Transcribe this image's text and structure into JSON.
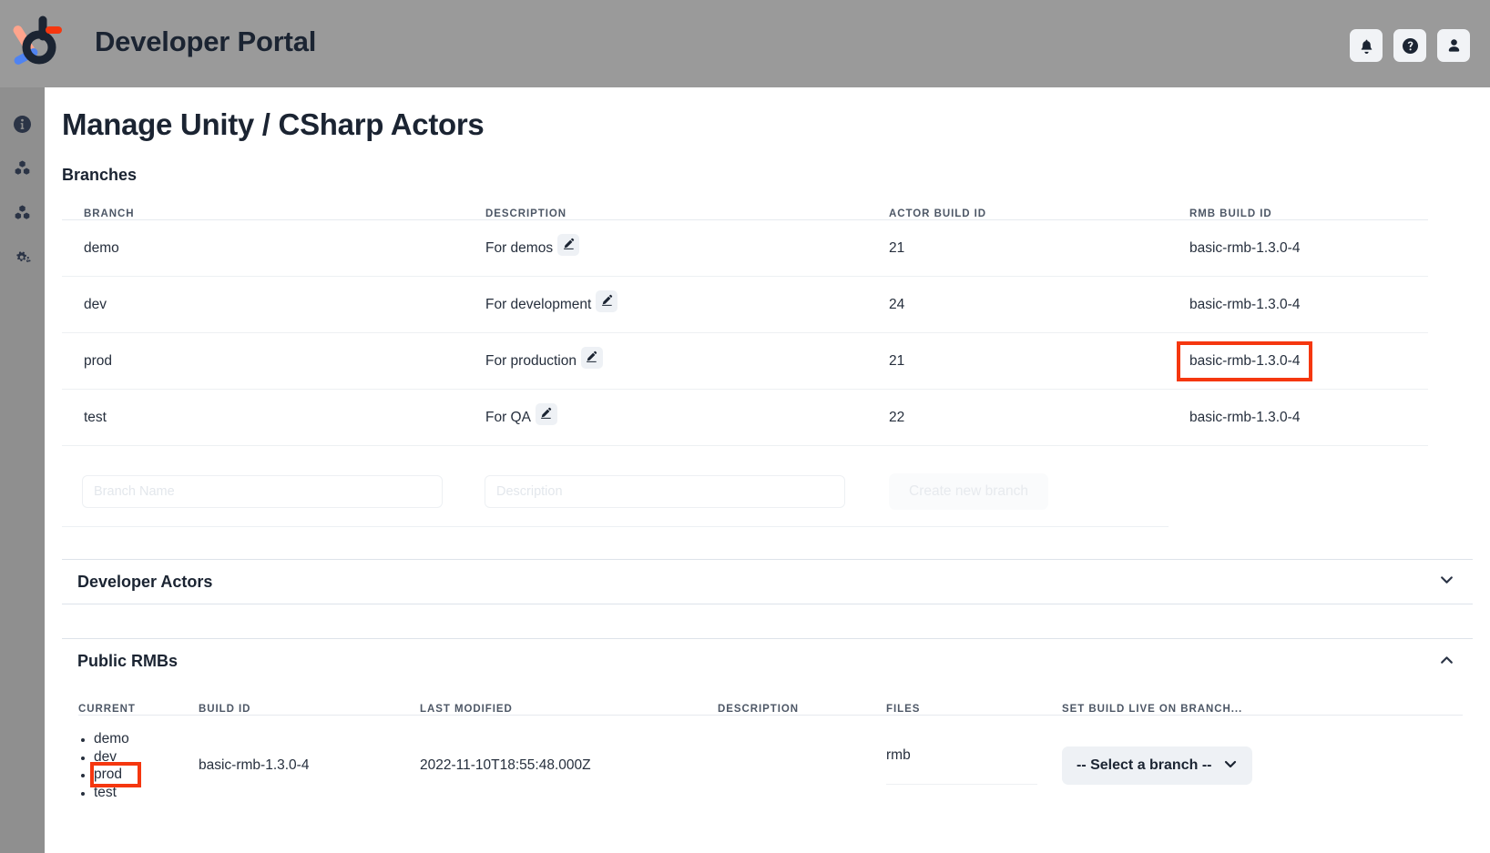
{
  "topbar": {
    "app_title": "Developer Portal",
    "logo_name": "beamable-logo",
    "actions": [
      {
        "name": "notifications-button",
        "icon": "bell-icon"
      },
      {
        "name": "help-button",
        "icon": "question-circle-icon"
      },
      {
        "name": "account-button",
        "icon": "user-icon"
      }
    ]
  },
  "sidebar": {
    "items": [
      {
        "name": "sidebar-item-info",
        "icon": "info-circle-icon"
      },
      {
        "name": "sidebar-item-content",
        "icon": "cubes-icon"
      },
      {
        "name": "sidebar-item-builds",
        "icon": "cubes-icon"
      },
      {
        "name": "sidebar-item-settings",
        "icon": "gears-icon"
      }
    ]
  },
  "page": {
    "title": "Manage Unity / CSharp Actors"
  },
  "branches": {
    "heading": "Branches",
    "columns": {
      "branch": "BRANCH",
      "description": "DESCRIPTION",
      "actor_build_id": "ACTOR BUILD ID",
      "rmb_build_id": "RMB BUILD ID"
    },
    "rows": [
      {
        "branch": "demo",
        "description": "For demos",
        "actor_build_id": "21",
        "rmb_build_id": "basic-rmb-1.3.0-4",
        "highlighted": false
      },
      {
        "branch": "dev",
        "description": "For development",
        "actor_build_id": "24",
        "rmb_build_id": "basic-rmb-1.3.0-4",
        "highlighted": false
      },
      {
        "branch": "prod",
        "description": "For production",
        "actor_build_id": "21",
        "rmb_build_id": "basic-rmb-1.3.0-4",
        "highlighted": true
      },
      {
        "branch": "test",
        "description": "For QA",
        "actor_build_id": "22",
        "rmb_build_id": "basic-rmb-1.3.0-4",
        "highlighted": false
      }
    ],
    "form": {
      "branch_name_value": "",
      "branch_name_placeholder": "Branch Name",
      "description_value": "",
      "description_placeholder": "Description",
      "create_label": "Create new branch"
    }
  },
  "developer_actors": {
    "title": "Developer Actors",
    "expanded": false,
    "chevron": "chevron-down-icon"
  },
  "public_rmbs": {
    "title": "Public RMBs",
    "expanded": true,
    "chevron": "chevron-up-icon",
    "columns": {
      "current": "CURRENT",
      "build_id": "BUILD ID",
      "last_modified": "LAST MODIFIED",
      "description": "DESCRIPTION",
      "files": "FILES",
      "set_live": "SET BUILD LIVE ON BRANCH..."
    },
    "rows": [
      {
        "current": [
          "demo",
          "dev",
          "prod",
          "test"
        ],
        "current_highlighted": "prod",
        "build_id": "basic-rmb-1.3.0-4",
        "last_modified": "2022-11-10T18:55:48.000Z",
        "description": "",
        "files": "rmb",
        "set_live_label": "-- Select a branch --",
        "set_live_chevron": "chevron-down-icon"
      }
    ]
  },
  "colors": {
    "highlight": "#f5370f",
    "topbar_bg": "#9a9a9a",
    "rail_bg": "#8f8f8f",
    "text_dark": "#1b2432",
    "chip_bg": "#eef1f5"
  }
}
